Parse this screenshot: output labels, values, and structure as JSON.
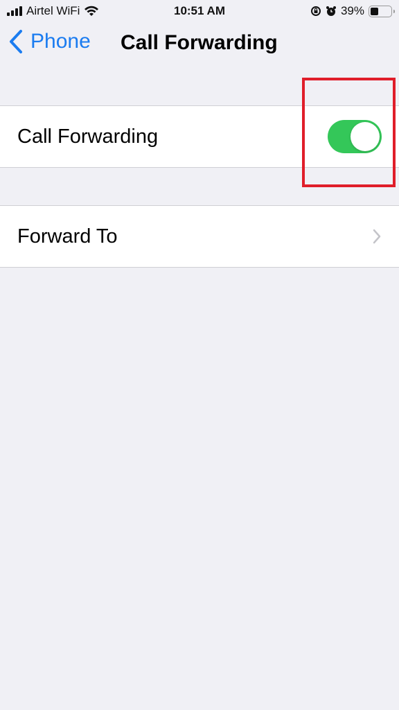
{
  "status_bar": {
    "carrier": "Airtel WiFi",
    "time": "10:51 AM",
    "battery_percent": "39%",
    "battery_level": 0.39,
    "icons": [
      "signal-icon",
      "wifi-icon",
      "orientation-lock-icon",
      "alarm-icon",
      "battery-icon"
    ]
  },
  "nav": {
    "back_label": "Phone",
    "title": "Call Forwarding"
  },
  "settings": {
    "call_forwarding": {
      "label": "Call Forwarding",
      "enabled": true,
      "toggle_color": "#34c759"
    },
    "forward_to": {
      "label": "Forward To"
    }
  },
  "annotation": {
    "highlight_color": "#e01e2a",
    "target": "call-forwarding-toggle"
  },
  "colors": {
    "accent": "#1b7cf0",
    "background": "#f0f0f5"
  }
}
